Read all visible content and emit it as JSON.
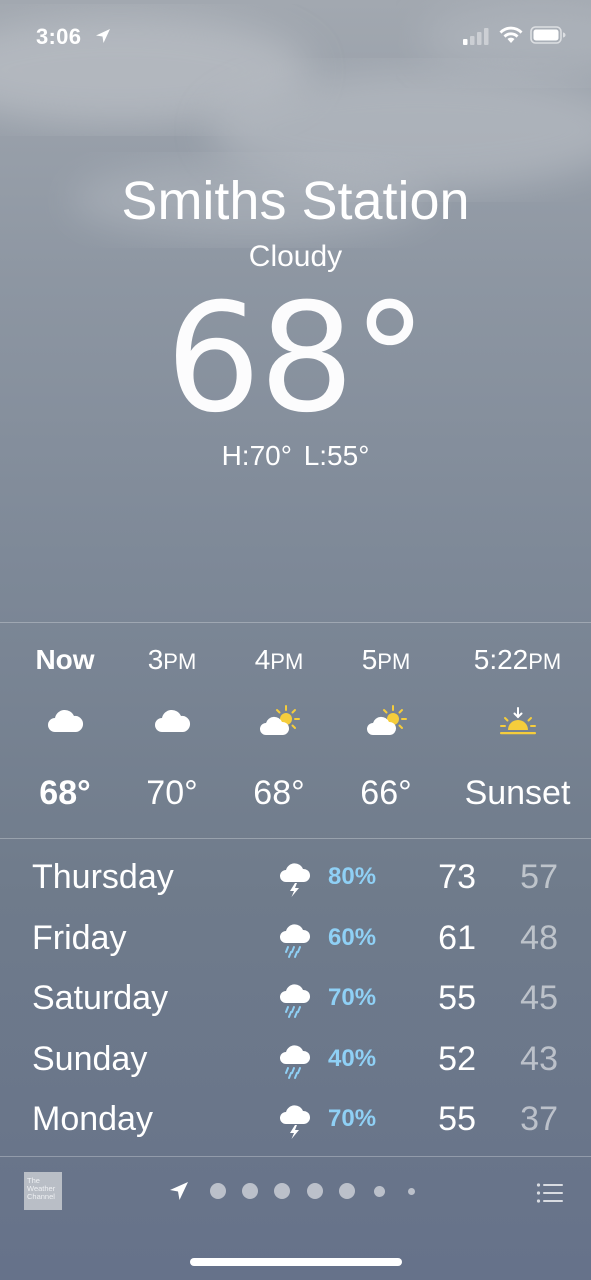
{
  "status_bar": {
    "time": "3:06",
    "icons": [
      "location-arrow-icon",
      "cellular-signal-icon",
      "wifi-icon",
      "battery-icon"
    ]
  },
  "current": {
    "city": "Smiths Station",
    "condition": "Cloudy",
    "temperature": "68°",
    "high_low": "H:70°  L:55°"
  },
  "hourly": [
    {
      "label": "Now",
      "suffix": "",
      "icon": "cloud-icon",
      "temp": "68°"
    },
    {
      "label": "3",
      "suffix": "PM",
      "icon": "cloud-icon",
      "temp": "70°"
    },
    {
      "label": "4",
      "suffix": "PM",
      "icon": "partly-sunny-icon",
      "temp": "68°"
    },
    {
      "label": "5",
      "suffix": "PM",
      "icon": "partly-sunny-icon",
      "temp": "66°"
    },
    {
      "label": "5:22",
      "suffix": "PM",
      "icon": "sunset-icon",
      "temp": "Sunset"
    }
  ],
  "daily": [
    {
      "day": "Thursday",
      "icon": "thunderstorm-icon",
      "precip": "80%",
      "high": "73",
      "low": "57"
    },
    {
      "day": "Friday",
      "icon": "rain-icon",
      "precip": "60%",
      "high": "61",
      "low": "48"
    },
    {
      "day": "Saturday",
      "icon": "rain-icon",
      "precip": "70%",
      "high": "55",
      "low": "45"
    },
    {
      "day": "Sunday",
      "icon": "rain-icon",
      "precip": "40%",
      "high": "52",
      "low": "43"
    },
    {
      "day": "Monday",
      "icon": "thunderstorm-icon",
      "precip": "70%",
      "high": "55",
      "low": "37"
    }
  ],
  "bottom_bar": {
    "logo_text": "The Weather Channel",
    "page_count": 7,
    "active_page": 0
  },
  "colors": {
    "precip": "#8fd0f5",
    "sun": "#f5cd3c"
  }
}
